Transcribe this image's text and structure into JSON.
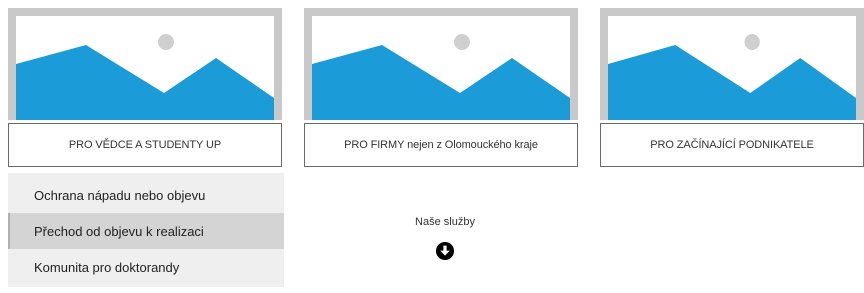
{
  "cards": [
    {
      "label": "PRO VĚDCE A STUDENTY UP",
      "image_icon": "placeholder-image-icon"
    },
    {
      "label": "PRO FIRMY nejen z Olomouckého kraje",
      "image_icon": "placeholder-image-icon"
    },
    {
      "label": "PRO ZAČÍNAJÍCÍ PODNIKATELE",
      "image_icon": "placeholder-image-icon"
    }
  ],
  "menu": {
    "items": [
      {
        "label": "Ochrana nápadu nebo objevu",
        "active": false
      },
      {
        "label": "Přechod od objevu k realizaci",
        "active": true
      },
      {
        "label": "Komunita pro doktorandy",
        "active": false
      }
    ]
  },
  "services": {
    "label": "Naše služby",
    "icon": "arrow-down-circle-icon"
  },
  "colors": {
    "image_frame": "#c9c9c9",
    "mountain": "#1b9bd7",
    "sun": "#cfcfcf",
    "menu_bg": "#efefef",
    "menu_active": "#d4d4d4"
  }
}
